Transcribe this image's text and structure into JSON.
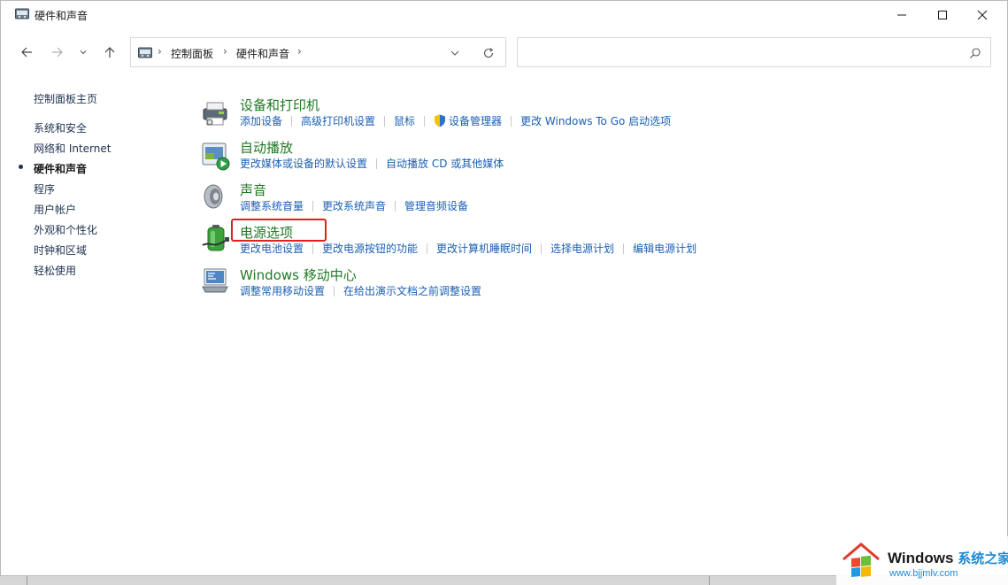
{
  "window": {
    "title": "硬件和声音"
  },
  "controls": {
    "minimize_icon": "minimize-icon",
    "maximize_icon": "maximize-icon",
    "close_icon": "close-icon"
  },
  "nav": {
    "breadcrumb": [
      "控制面板",
      "硬件和声音"
    ],
    "search_placeholder": ""
  },
  "sidebar": {
    "items": [
      {
        "label": "控制面板主页",
        "current": false
      },
      {
        "label": "系统和安全",
        "current": false
      },
      {
        "label": "网络和 Internet",
        "current": false
      },
      {
        "label": "硬件和声音",
        "current": true
      },
      {
        "label": "程序",
        "current": false
      },
      {
        "label": "用户帐户",
        "current": false
      },
      {
        "label": "外观和个性化",
        "current": false
      },
      {
        "label": "时钟和区域",
        "current": false
      },
      {
        "label": "轻松使用",
        "current": false
      }
    ]
  },
  "categories": [
    {
      "title": "设备和打印机",
      "icon": "printer-icon",
      "links": [
        "添加设备",
        "高级打印机设置",
        "鼠标",
        "设备管理器",
        "更改 Windows To Go 启动选项"
      ]
    },
    {
      "title": "自动播放",
      "icon": "autoplay-icon",
      "links": [
        "更改媒体或设备的默认设置",
        "自动播放 CD 或其他媒体"
      ]
    },
    {
      "title": "声音",
      "icon": "speaker-icon",
      "links": [
        "调整系统音量",
        "更改系统声音",
        "管理音频设备"
      ]
    },
    {
      "title": "电源选项",
      "icon": "battery-icon",
      "links": [
        "更改电池设置",
        "更改电源按钮的功能",
        "更改计算机睡眠时间",
        "选择电源计划",
        "编辑电源计划"
      ]
    },
    {
      "title": "Windows 移动中心",
      "icon": "mobility-center-icon",
      "links": [
        "调整常用移动设置",
        "在给出演示文档之前调整设置"
      ]
    }
  ],
  "colors": {
    "category_title": "#1f7a24",
    "link": "#1a5fb4",
    "highlight": "#e02020"
  },
  "watermark": {
    "title_en": "Windows",
    "title_cn": "系统之家",
    "url": "www.bjjmlv.com"
  }
}
